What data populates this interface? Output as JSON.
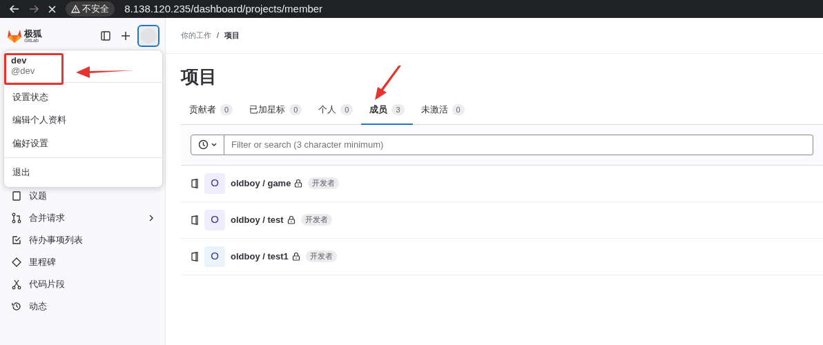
{
  "browser": {
    "security": "不安全",
    "url": "8.138.120.235/dashboard/projects/member"
  },
  "brand": {
    "name": "极狐",
    "sub": "GitLab"
  },
  "user_menu": {
    "name": "dev",
    "handle": "@dev",
    "groups": [
      [
        "设置状态",
        "编辑个人资料",
        "偏好设置"
      ],
      [
        "退出"
      ]
    ]
  },
  "sidebar": {
    "items": [
      {
        "label": "议题",
        "has_children": false
      },
      {
        "label": "合并请求",
        "has_children": true
      },
      {
        "label": "待办事项列表",
        "has_children": false
      },
      {
        "label": "里程碑",
        "has_children": false
      },
      {
        "label": "代码片段",
        "has_children": false
      },
      {
        "label": "动态",
        "has_children": false
      }
    ]
  },
  "breadcrumb": {
    "items": [
      "你的工作",
      "项目"
    ],
    "separator": "/"
  },
  "title": "项目",
  "tabs": [
    {
      "label": "贡献者",
      "count": "0",
      "selected": false
    },
    {
      "label": "已加星标",
      "count": "0",
      "selected": false
    },
    {
      "label": "个人",
      "count": "0",
      "selected": false
    },
    {
      "label": "成员",
      "count": "3",
      "selected": true
    },
    {
      "label": "未激活",
      "count": "0",
      "selected": false
    }
  ],
  "search": {
    "placeholder": "Filter or search (3 character minimum)"
  },
  "projects": [
    {
      "initial": "O",
      "name": "oldboy / game",
      "role": "开发者",
      "color": "#f0edff"
    },
    {
      "initial": "O",
      "name": "oldboy / test",
      "role": "开发者",
      "color": "#f0edff"
    },
    {
      "initial": "O",
      "name": "oldboy / test1",
      "role": "开发者",
      "color": "#e9f3fc"
    }
  ]
}
